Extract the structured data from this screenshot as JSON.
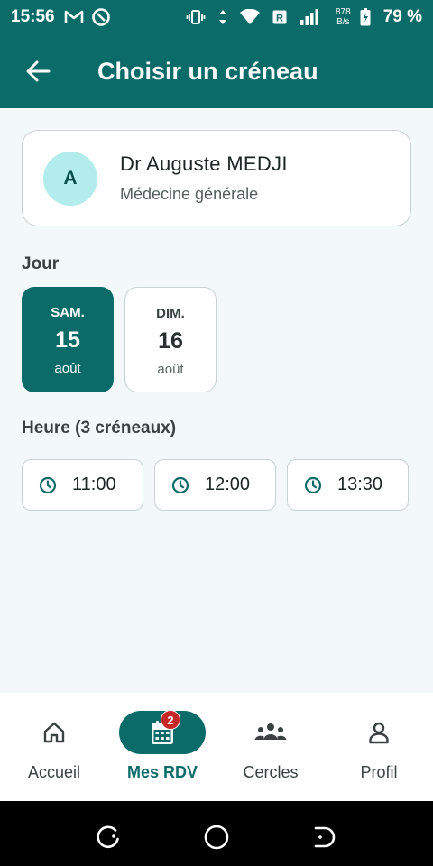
{
  "status_bar": {
    "time": "15:56",
    "left_icons": [
      "gmail-icon",
      "vpn-icon"
    ],
    "right_icons": [
      "vibrate-icon",
      "data-arrows-icon",
      "wifi-icon",
      "roaming-r-icon",
      "signal-icon"
    ],
    "speed_value": "878",
    "speed_unit": "B/s",
    "battery": "79 %"
  },
  "app_bar": {
    "title": "Choisir un créneau",
    "back_icon": "arrow-left-icon"
  },
  "doctor": {
    "initial": "A",
    "name": "Dr Auguste MEDJI",
    "specialty": "Médecine générale"
  },
  "day_section": {
    "label": "Jour",
    "days": [
      {
        "weekday": "SAM.",
        "day": "15",
        "month": "août",
        "selected": true
      },
      {
        "weekday": "DIM.",
        "day": "16",
        "month": "août",
        "selected": false
      }
    ]
  },
  "time_section": {
    "label": "Heure (3 créneaux)",
    "slots": [
      {
        "time": "11:00",
        "icon": "clock-icon"
      },
      {
        "time": "12:00",
        "icon": "clock-icon"
      },
      {
        "time": "13:30",
        "icon": "clock-icon"
      }
    ]
  },
  "bottom_nav": {
    "items": [
      {
        "label": "Accueil",
        "icon": "home-icon",
        "active": false
      },
      {
        "label": "Mes RDV",
        "icon": "calendar-icon",
        "active": true,
        "badge": "2"
      },
      {
        "label": "Cercles",
        "icon": "groups-icon",
        "active": false
      },
      {
        "label": "Profil",
        "icon": "person-icon",
        "active": false
      }
    ]
  },
  "colors": {
    "primary": "#0b6b68",
    "background": "#f3f8f8",
    "avatar_bg": "#b3ecec",
    "badge": "#c62828"
  }
}
